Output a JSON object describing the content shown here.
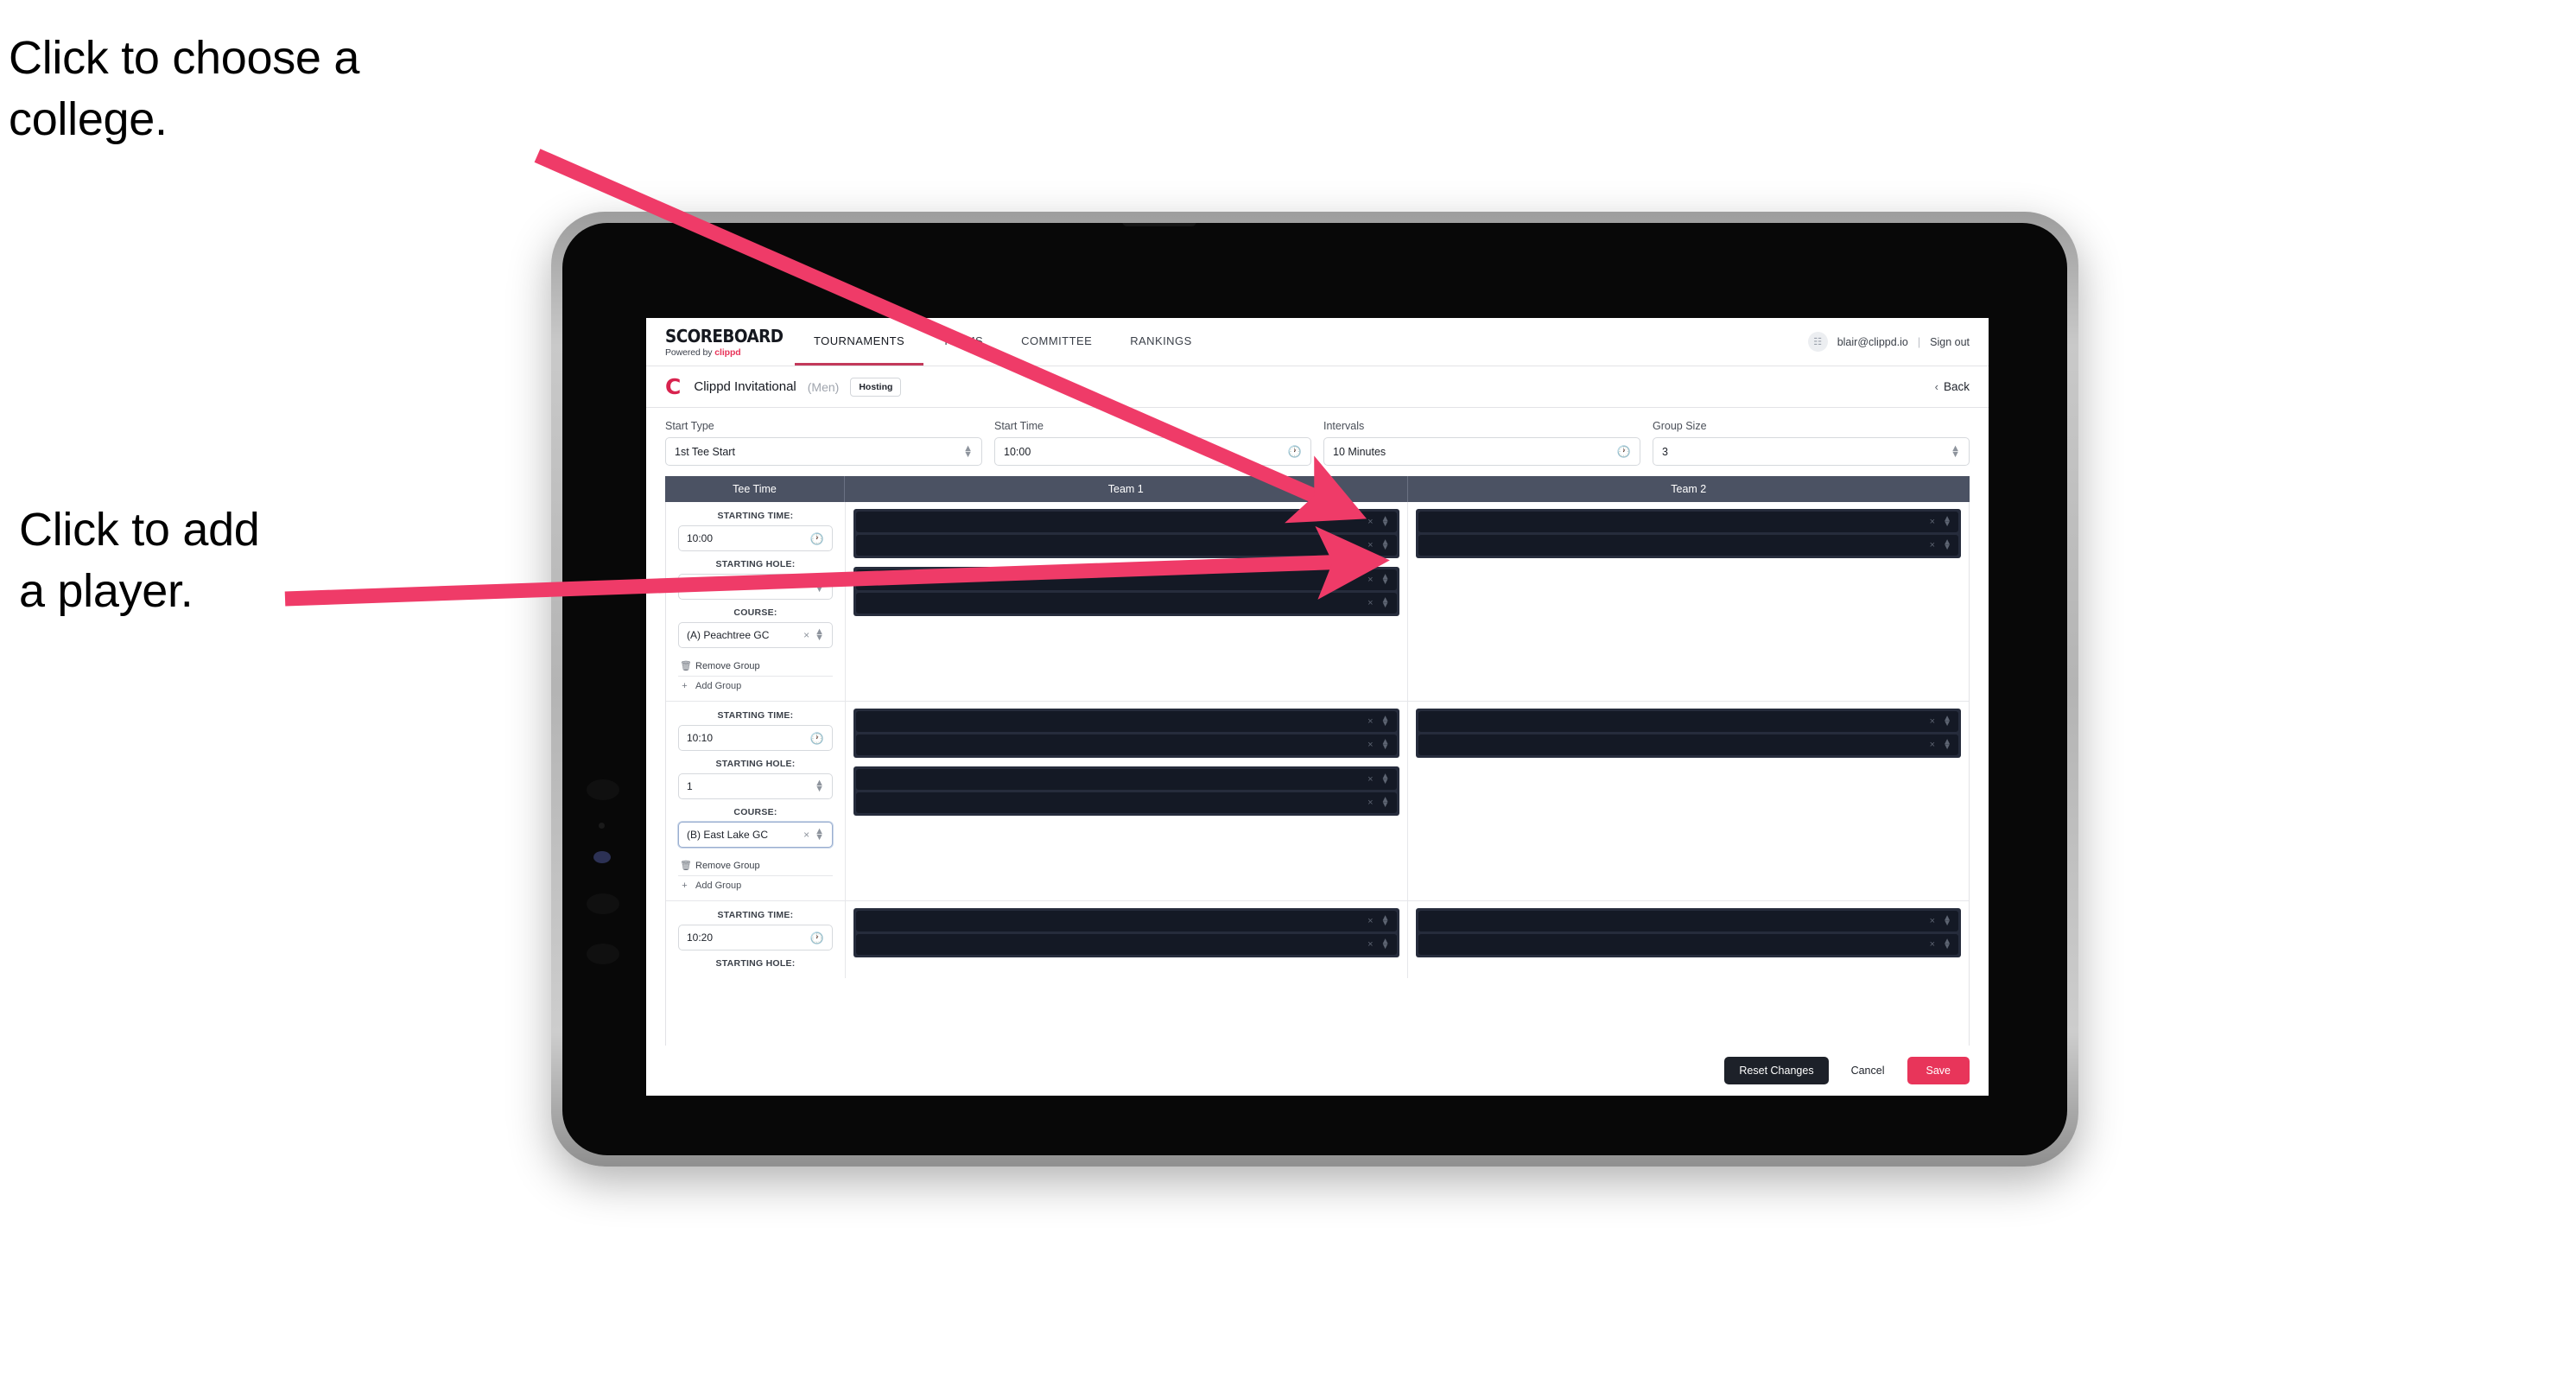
{
  "annotations": {
    "college": "Click to choose a\ncollege.",
    "player": "Click to add\na player."
  },
  "colors": {
    "accent": "#e8355a",
    "brand_dark": "#15181f",
    "table_header": "#4b5263",
    "player_row": "#141925",
    "player_group": "#262c3c",
    "tablet_bezel": "#b4b4b4"
  },
  "topnav": {
    "brand_main": "SCOREBOARD",
    "brand_sub_prefix": "Powered by ",
    "brand_sub_name": "clippd",
    "tabs": [
      {
        "label": "TOURNAMENTS",
        "active": true
      },
      {
        "label": "TEAMS",
        "active": false
      },
      {
        "label": "COMMITTEE",
        "active": false
      },
      {
        "label": "RANKINGS",
        "active": false
      }
    ],
    "avatar_glyph": "☷",
    "user_email": "blair@clippd.io",
    "separator": "|",
    "sign_out": "Sign out"
  },
  "tournament_bar": {
    "logo_letter": "C",
    "title": "Clippd Invitational",
    "gender": "(Men)",
    "badge": "Hosting",
    "back_chevron": "‹",
    "back_label": "Back"
  },
  "controls": [
    {
      "label": "Start Type",
      "value": "1st Tee Start",
      "adornment": "spinner"
    },
    {
      "label": "Start Time",
      "value": "10:00",
      "adornment": "clock"
    },
    {
      "label": "Intervals",
      "value": "10 Minutes",
      "adornment": "clock"
    },
    {
      "label": "Group Size",
      "value": "3",
      "adornment": "spinner"
    }
  ],
  "table": {
    "headers": [
      "Tee Time",
      "Team 1",
      "Team 2"
    ],
    "field_labels": {
      "starting_time": "STARTING TIME:",
      "starting_hole": "STARTING HOLE:",
      "course": "COURSE:"
    },
    "group_actions": {
      "remove": "Remove Group",
      "remove_icon": "☐",
      "add": "Add Group",
      "add_icon": "+"
    },
    "clear_icon": "×",
    "rows": [
      {
        "starting_time": "10:00",
        "starting_hole": "1",
        "course": "(A) Peachtree GC",
        "course_focused": false,
        "team1": [
          {
            "players": 2,
            "wide": false
          },
          {
            "players": 2,
            "wide": false
          }
        ],
        "team2": [
          {
            "players": 2,
            "wide": true
          }
        ]
      },
      {
        "starting_time": "10:10",
        "starting_hole": "1",
        "course": "(B) East Lake GC",
        "course_focused": true,
        "team1": [
          {
            "players": 2,
            "wide": false
          },
          {
            "players": 2,
            "wide": false
          }
        ],
        "team2": [
          {
            "players": 2,
            "wide": true
          }
        ]
      },
      {
        "starting_time": "10:20",
        "starting_hole": "",
        "course": "",
        "course_focused": false,
        "team1": [
          {
            "players": 2,
            "wide": true
          }
        ],
        "team2": [
          {
            "players": 2,
            "wide": true
          }
        ]
      }
    ]
  },
  "footer": {
    "reset": "Reset Changes",
    "cancel": "Cancel",
    "save": "Save"
  }
}
